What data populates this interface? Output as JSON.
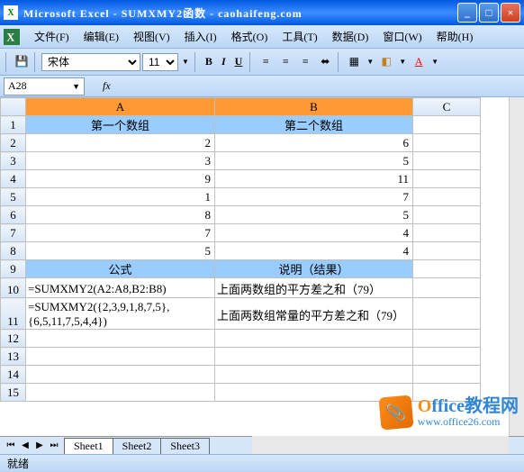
{
  "window": {
    "title": "Microsoft Excel - SUMXMY2函数 - caohaifeng.com"
  },
  "menu": {
    "file": "文件(F)",
    "edit": "编辑(E)",
    "view": "视图(V)",
    "insert": "插入(I)",
    "format": "格式(O)",
    "tools": "工具(T)",
    "data": "数据(D)",
    "window": "窗口(W)",
    "help": "帮助(H)"
  },
  "toolbar": {
    "font_name": "宋体",
    "font_size": "11",
    "bold": "B",
    "italic": "I",
    "underline": "U"
  },
  "namebox": {
    "cell": "A28",
    "fx": "fx"
  },
  "columns": {
    "a": "A",
    "b": "B",
    "c": "C"
  },
  "rows": [
    "1",
    "2",
    "3",
    "4",
    "5",
    "6",
    "7",
    "8",
    "9",
    "10",
    "11",
    "12",
    "13",
    "14",
    "15"
  ],
  "headers": {
    "a1": "第一个数组",
    "b1": "第二个数组",
    "a9": "公式",
    "b9": "说明（结果）"
  },
  "data": {
    "a2": "2",
    "b2": "6",
    "a3": "3",
    "b3": "5",
    "a4": "9",
    "b4": "11",
    "a5": "1",
    "b5": "7",
    "a6": "8",
    "b6": "5",
    "a7": "7",
    "b7": "4",
    "a8": "5",
    "b8": "4",
    "a10": "=SUMXMY2(A2:A8,B2:B8)",
    "b10": "上面两数组的平方差之和（79）",
    "a11": "=SUMXMY2({2,3,9,1,8,7,5},{6,5,11,7,5,4,4})",
    "b11": "上面两数组常量的平方差之和（79）"
  },
  "sheets": {
    "s1": "Sheet1",
    "s2": "Sheet2",
    "s3": "Sheet3"
  },
  "status": "就绪",
  "watermark": {
    "brand_o": "O",
    "brand_rest": "ffice教程网",
    "url": "www.office26.com"
  }
}
